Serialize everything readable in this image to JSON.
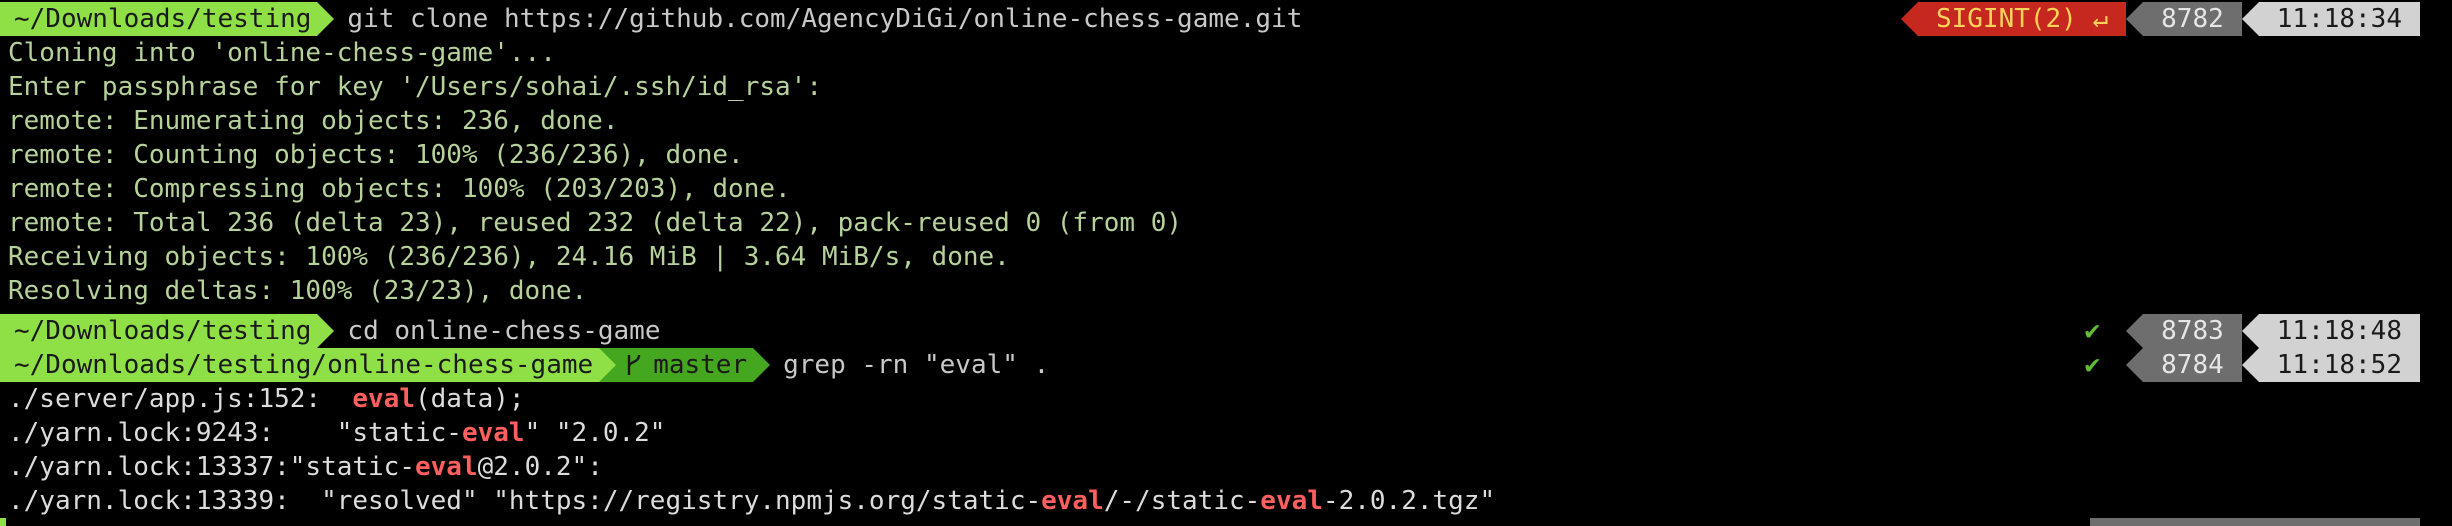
{
  "colors": {
    "background": "#000000",
    "path_segment": "#8fe046",
    "git_segment": "#45a61f",
    "error_segment": "#c6271f",
    "history_segment": "#6e6e6e",
    "time_segment": "#d2d2d2",
    "output_text": "#b6d29a",
    "match_highlight": "#ff5f5f"
  },
  "prompts": [
    {
      "path": "~/Downloads/testing",
      "command": "git clone https://github.com/AgencyDiGi/online-chess-game.git",
      "status": "SIGINT(2) ↵",
      "history": "8782",
      "time": "11:18:34"
    },
    {
      "path": "~/Downloads/testing",
      "command": "cd online-chess-game",
      "status": "✔",
      "history": "8783",
      "time": "11:18:48"
    },
    {
      "path": "~/Downloads/testing/online-chess-game",
      "branch": "master",
      "branch_icon": "git-branch-icon",
      "command": "grep -rn \"eval\" .",
      "status": "✔",
      "history": "8784",
      "time": "11:18:52"
    }
  ],
  "clone_output": [
    "Cloning into 'online-chess-game'...",
    "Enter passphrase for key '/Users/sohai/.ssh/id_rsa':",
    "remote: Enumerating objects: 236, done.",
    "remote: Counting objects: 100% (236/236), done.",
    "remote: Compressing objects: 100% (203/203), done.",
    "remote: Total 236 (delta 23), reused 232 (delta 22), pack-reused 0 (from 0)",
    "Receiving objects: 100% (236/236), 24.16 MiB | 3.64 MiB/s, done.",
    "Resolving deltas: 100% (23/23), done."
  ],
  "grep_output": [
    {
      "a": "./server/app.js:152:  ",
      "m1": "eval",
      "b": "(data);"
    },
    {
      "a": "./yarn.lock:9243:    \"static-",
      "m1": "eval",
      "b": "\" \"2.0.2\""
    },
    {
      "a": "./yarn.lock:13337:\"static-",
      "m1": "eval",
      "b": "@2.0.2\":"
    },
    {
      "a": "./yarn.lock:13339:  \"resolved\" \"https://registry.npmjs.org/static-",
      "m1": "eval",
      "b": "/-/static-",
      "m2": "eval",
      "c": "-2.0.2.tgz\""
    }
  ]
}
